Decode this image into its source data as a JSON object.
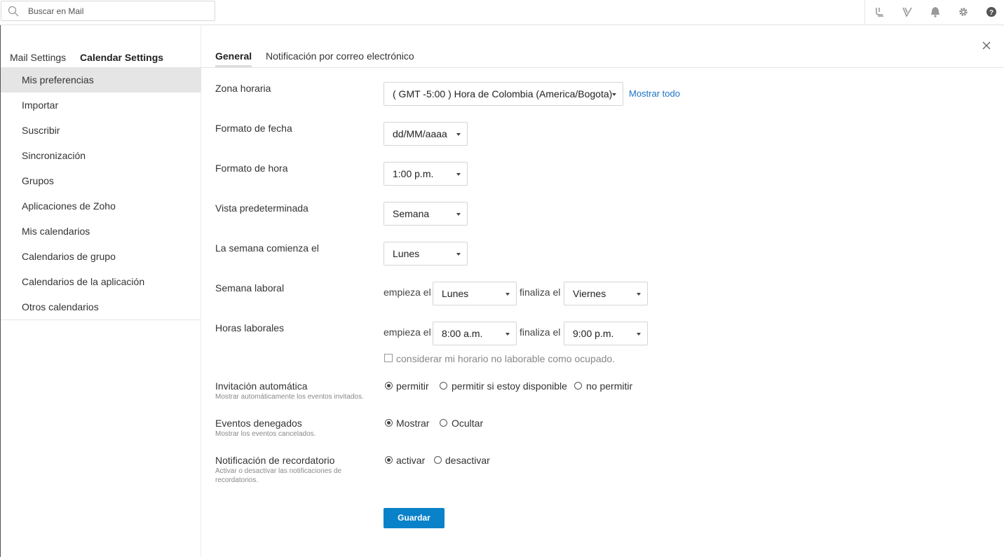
{
  "search": {
    "placeholder": "Buscar en Mail"
  },
  "top_icons": [
    "contacts-icon",
    "vowel-icon",
    "bell-icon",
    "gear-icon",
    "help-icon"
  ],
  "sidebar": {
    "tabs": [
      {
        "label": "Mail Settings",
        "active": false
      },
      {
        "label": "Calendar Settings",
        "active": true
      }
    ],
    "items": [
      {
        "label": "Mis preferencias",
        "selected": true
      },
      {
        "label": "Importar"
      },
      {
        "label": "Suscribir"
      },
      {
        "label": "Sincronización"
      },
      {
        "label": "Grupos"
      },
      {
        "label": "Aplicaciones de Zoho"
      },
      {
        "label": "Mis calendarios"
      },
      {
        "label": "Calendarios de grupo"
      },
      {
        "label": "Calendarios de la aplicación"
      },
      {
        "label": "Otros calendarios"
      }
    ]
  },
  "main": {
    "tabs": [
      {
        "label": "General",
        "active": true
      },
      {
        "label": "Notificación por correo electrónico",
        "active": false
      }
    ],
    "timezone": {
      "label": "Zona horaria",
      "value": "( GMT -5:00 ) Hora de Colombia (America/Bogota)",
      "link": "Mostrar todo"
    },
    "date_format": {
      "label": "Formato de fecha",
      "value": "dd/MM/aaaa"
    },
    "time_format": {
      "label": "Formato de hora",
      "value": "1:00 p.m."
    },
    "default_view": {
      "label": "Vista predeterminada",
      "value": "Semana"
    },
    "week_start": {
      "label": "La semana comienza el",
      "value": "Lunes"
    },
    "work_week": {
      "label": "Semana laboral",
      "starts_text": "empieza el",
      "start": "Lunes",
      "ends_text": "finaliza el",
      "end": "Viernes"
    },
    "work_hours": {
      "label": "Horas laborales",
      "starts_text": "empieza el",
      "start": "8:00 a.m.",
      "ends_text": "finaliza el",
      "end": "9:00 p.m.",
      "checkbox_label": "considerar mi horario no laborable como ocupado.",
      "checked": false
    },
    "auto_invite": {
      "label": "Invitación automática",
      "sub": "Mostrar automáticamente los eventos invitados.",
      "options": [
        {
          "label": "permitir",
          "selected": true
        },
        {
          "label": "permitir si estoy disponible",
          "selected": false
        },
        {
          "label": "no permitir",
          "selected": false
        }
      ]
    },
    "declined": {
      "label": "Eventos denegados",
      "sub": "Mostrar los eventos cancelados.",
      "options": [
        {
          "label": "Mostrar",
          "selected": true
        },
        {
          "label": "Ocultar",
          "selected": false
        }
      ]
    },
    "reminder": {
      "label": "Notificación de recordatorio",
      "sub": "Activar o desactivar las notificaciones de recordatorios.",
      "options": [
        {
          "label": "activar",
          "selected": true
        },
        {
          "label": "desactivar",
          "selected": false
        }
      ]
    },
    "save_label": "Guardar"
  },
  "colors": {
    "accent": "#0a82c9",
    "link": "#1a73c8",
    "selected_bg": "#e5e5e5"
  }
}
